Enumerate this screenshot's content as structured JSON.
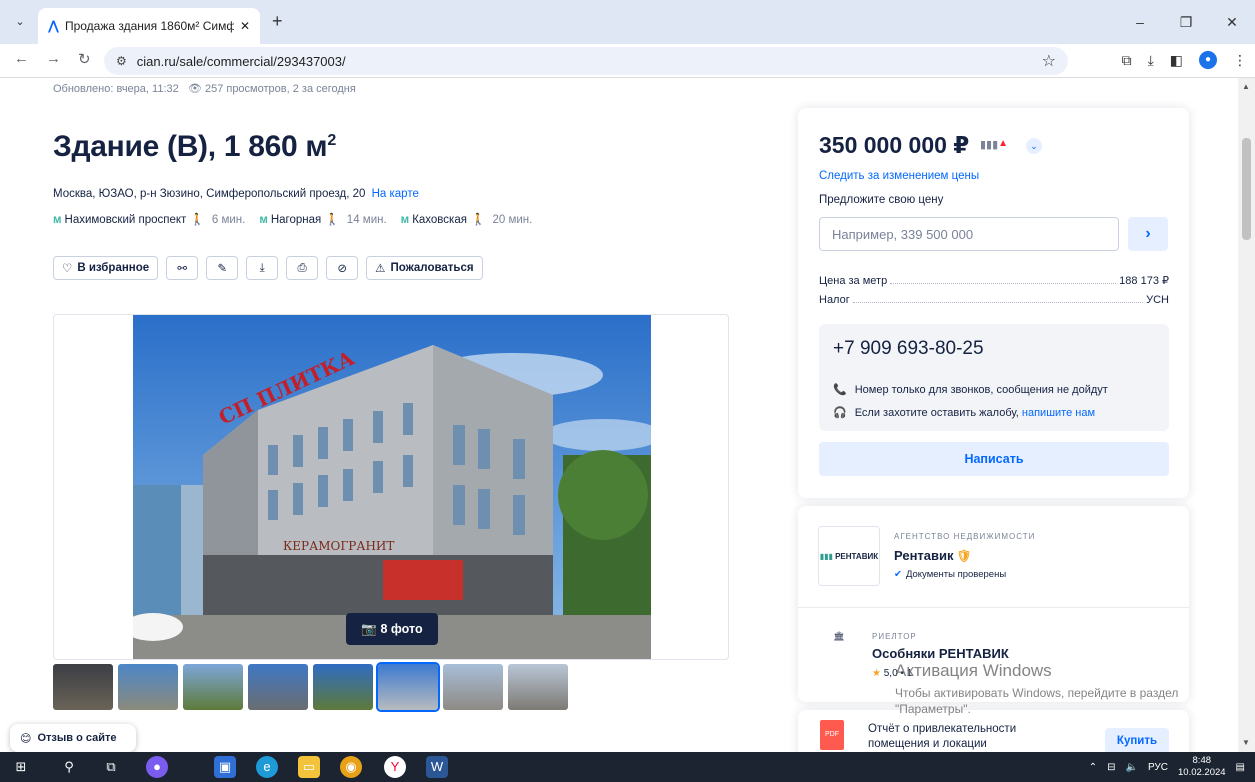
{
  "browser": {
    "tab_title": "Продажа здания 1860м² Симф",
    "url": "cian.ru/sale/commercial/293437003/"
  },
  "listing": {
    "updated": "Обновлено: вчера, 11:32",
    "views": "257 просмотров, 2 за сегодня",
    "title": "Здание (В), 1 860 м",
    "title_sup": "2",
    "address": "Москва, ЮЗАО, р-н Зюзино, Симферопольский проезд, 20",
    "map_link": "На карте",
    "metro": [
      {
        "station": "Нахимовский проспект",
        "time": "6 мин."
      },
      {
        "station": "Нагорная",
        "time": "14 мин."
      },
      {
        "station": "Каховская",
        "time": "20 мин."
      }
    ],
    "actions": {
      "favorite": "В избранное",
      "complain": "Пожаловаться"
    },
    "photo_count": "8 фото"
  },
  "price_card": {
    "price": "350 000 000 ₽",
    "follow": "Следить за изменением цены",
    "offer_label": "Предложите свою цену",
    "offer_placeholder": "Например, 339 500 000",
    "price_per_m_label": "Цена за метр",
    "price_per_m_value": "188 173 ₽",
    "tax_label": "Налог",
    "tax_value": "УСН",
    "phone": "+7 909 693-80-25",
    "note_calls": "Номер только для звонков, сообщения не дойдут",
    "note_complaint": "Если захотите оставить жалобу,",
    "note_complaint_link": "напишите нам",
    "write_btn": "Написать"
  },
  "agency": {
    "tag": "АГЕНТСТВО НЕДВИЖИМОСТИ",
    "logo_text": "РЕНТАВИК",
    "name": "Рентавик",
    "verified": "Документы проверены",
    "realtor_tag": "РИЕЛТОР",
    "realtor_name": "Особняки РЕНТАВИК",
    "rating": "5,0 • 1"
  },
  "report": {
    "pdf": "PDF",
    "title": "Отчёт о привлекательности помещения и локации",
    "buy": "Купить"
  },
  "feedback": "Отзыв о сайте",
  "windows_activation": {
    "title": "Активация Windows",
    "text": "Чтобы активировать Windows, перейдите в раздел \"Параметры\"."
  },
  "taskbar": {
    "lang": "РУС",
    "time": "8:48",
    "date": "10.02.2024"
  }
}
